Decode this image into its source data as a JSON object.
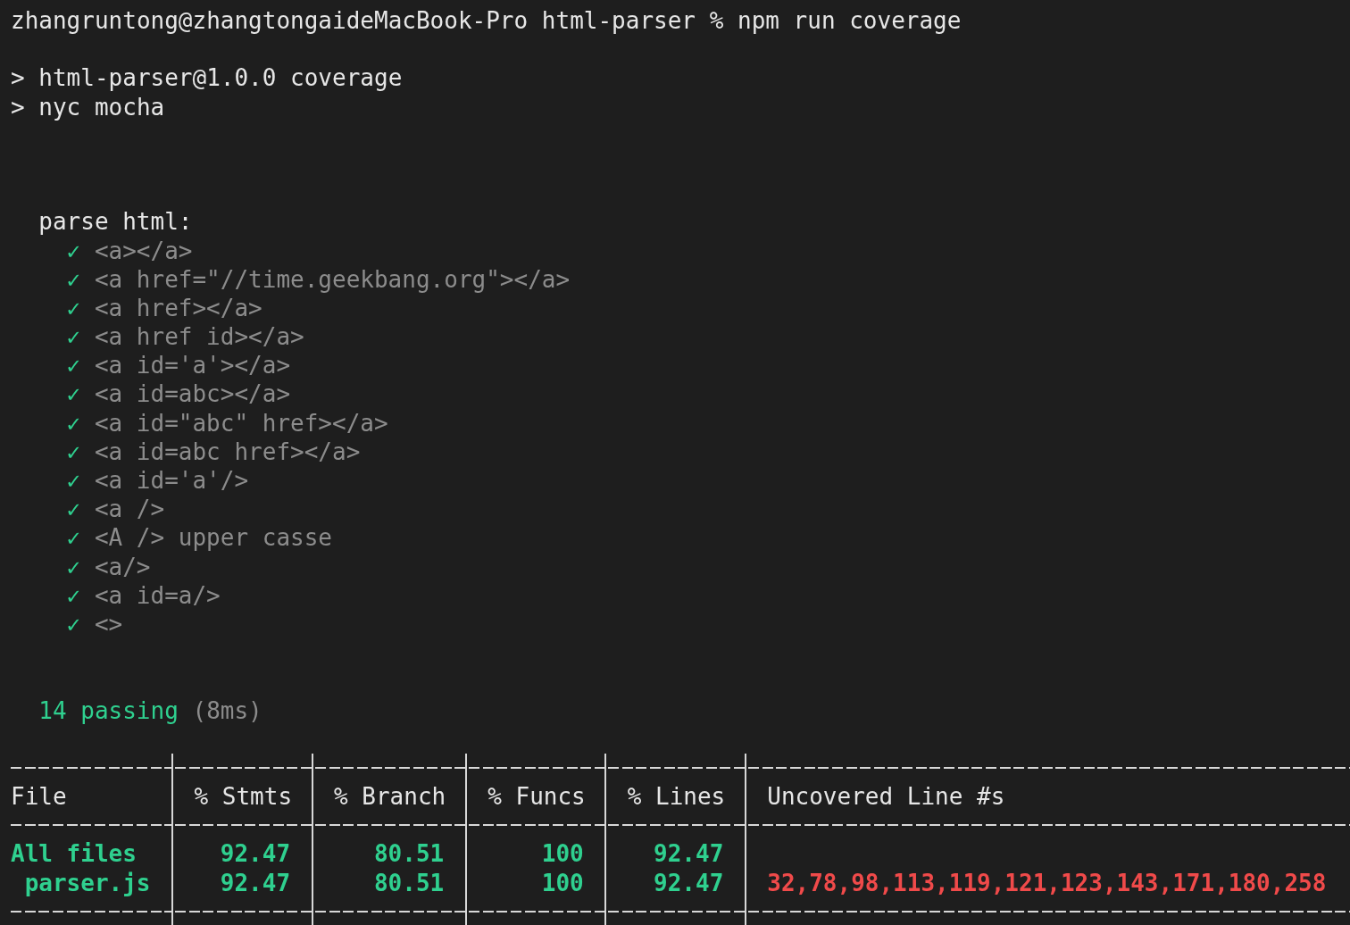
{
  "prompt": {
    "text": "zhangruntong@zhangtongaideMacBook-Pro html-parser % npm run coverage"
  },
  "script_lines": [
    "> html-parser@1.0.0 coverage",
    "> nyc mocha"
  ],
  "suite": {
    "title": "parse html:",
    "tests": [
      {
        "mark": "✓",
        "name": "<a></a>",
        "passed": true
      },
      {
        "mark": "✓",
        "name": "<a href=\"//time.geekbang.org\"></a>",
        "passed": true
      },
      {
        "mark": "✓",
        "name": "<a href></a>",
        "passed": true
      },
      {
        "mark": "✓",
        "name": "<a href id></a>",
        "passed": true
      },
      {
        "mark": "✓",
        "name": "<a id='a'></a>",
        "passed": true
      },
      {
        "mark": "✓",
        "name": "<a id=abc></a>",
        "passed": true
      },
      {
        "mark": "✓",
        "name": "<a id=\"abc\" href></a>",
        "passed": true
      },
      {
        "mark": "✓",
        "name": "<a id=abc href></a>",
        "passed": true
      },
      {
        "mark": "✓",
        "name": "<a id='a'/>",
        "passed": true
      },
      {
        "mark": "✓",
        "name": "<a />",
        "passed": true
      },
      {
        "mark": "✓",
        "name": "<A /> upper casse",
        "passed": true
      },
      {
        "mark": "✓",
        "name": "<a/>",
        "passed": true
      },
      {
        "mark": "✓",
        "name": "<a id=a/>",
        "passed": true
      },
      {
        "mark": "✓",
        "name": "<>",
        "passed": true
      }
    ]
  },
  "summary": {
    "count": "14 passing",
    "duration": "(8ms)"
  },
  "coverage_table": {
    "columns": [
      "File",
      "% Stmts",
      "% Branch",
      "% Funcs",
      "% Lines",
      "Uncovered Line #s"
    ],
    "rows": [
      {
        "cells": [
          "All files",
          "92.47",
          "80.51",
          "100",
          "92.47"
        ],
        "children": [
          {
            "cells": [
              "parser.js",
              "92.47",
              "80.51",
              "100",
              "92.47",
              "32,78,98,113,119,121,123,143,171,180,258"
            ]
          }
        ]
      }
    ]
  }
}
